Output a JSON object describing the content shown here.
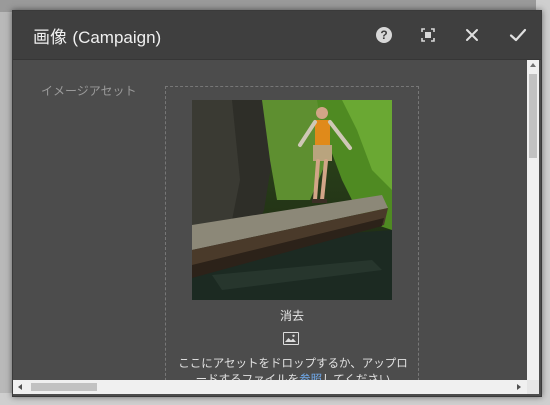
{
  "dialog": {
    "title_main": "画像",
    "title_sub": "(Campaign)",
    "actions": {
      "help": "help-icon",
      "fullscreen": "fullscreen-icon",
      "close": "close-icon",
      "done": "checkmark-icon"
    }
  },
  "field": {
    "label": "イメージアセット"
  },
  "dropzone": {
    "clear_label": "消去",
    "drop_text_before": "ここにアセットをドロップするか、アップロードするファイルを",
    "browse_link": "参照",
    "drop_text_after": "してください"
  },
  "colors": {
    "dialog_bg": "#4c4c4c",
    "header_bg": "#3f3f3f",
    "link": "#6fa8e8"
  }
}
